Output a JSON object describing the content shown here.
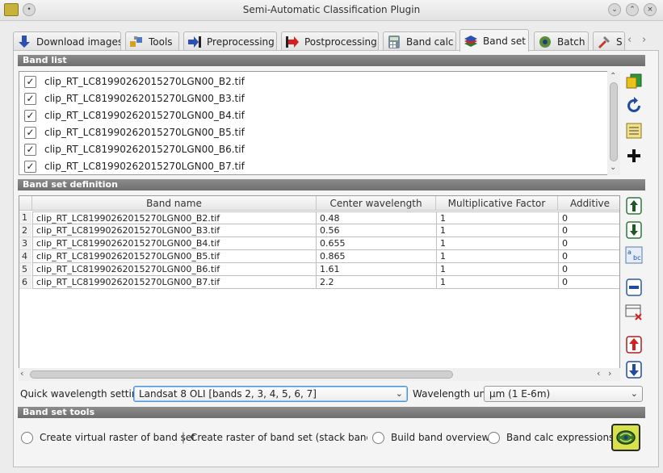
{
  "window": {
    "title": "Semi-Automatic Classification Plugin"
  },
  "tabs": [
    {
      "label": "Download images",
      "icon": "download-icon"
    },
    {
      "label": "Tools",
      "icon": "tools-icon"
    },
    {
      "label": "Preprocessing",
      "icon": "preprocessing-icon"
    },
    {
      "label": "Postprocessing",
      "icon": "postprocessing-icon"
    },
    {
      "label": "Band calc",
      "icon": "calculator-icon"
    },
    {
      "label": "Band set",
      "icon": "layers-icon",
      "active": true
    },
    {
      "label": "Batch",
      "icon": "batch-icon"
    },
    {
      "label": "S",
      "icon": "settings-icon"
    }
  ],
  "band_list": {
    "header": "Band list",
    "items": [
      {
        "label": "clip_RT_LC81990262015270LGN00_B2.tif",
        "checked": true
      },
      {
        "label": "clip_RT_LC81990262015270LGN00_B3.tif",
        "checked": true
      },
      {
        "label": "clip_RT_LC81990262015270LGN00_B4.tif",
        "checked": true
      },
      {
        "label": "clip_RT_LC81990262015270LGN00_B5.tif",
        "checked": true
      },
      {
        "label": "clip_RT_LC81990262015270LGN00_B6.tif",
        "checked": true
      },
      {
        "label": "clip_RT_LC81990262015270LGN00_B7.tif",
        "checked": true
      }
    ]
  },
  "band_set_definition": {
    "header": "Band set definition",
    "columns": [
      "Band name",
      "Center wavelength",
      "Multiplicative Factor",
      "Additive"
    ],
    "rows": [
      {
        "n": "1",
        "name": "clip_RT_LC81990262015270LGN00_B2.tif",
        "wl": "0.48",
        "mult": "1",
        "add": "0"
      },
      {
        "n": "2",
        "name": "clip_RT_LC81990262015270LGN00_B3.tif",
        "wl": "0.56",
        "mult": "1",
        "add": "0"
      },
      {
        "n": "3",
        "name": "clip_RT_LC81990262015270LGN00_B4.tif",
        "wl": "0.655",
        "mult": "1",
        "add": "0"
      },
      {
        "n": "4",
        "name": "clip_RT_LC81990262015270LGN00_B5.tif",
        "wl": "0.865",
        "mult": "1",
        "add": "0"
      },
      {
        "n": "5",
        "name": "clip_RT_LC81990262015270LGN00_B6.tif",
        "wl": "1.61",
        "mult": "1",
        "add": "0"
      },
      {
        "n": "6",
        "name": "clip_RT_LC81990262015270LGN00_B7.tif",
        "wl": "2.2",
        "mult": "1",
        "add": "0"
      }
    ]
  },
  "wavelength": {
    "quick_label": "Quick wavelength settings",
    "quick_value": "Landsat 8 OLI [bands 2, 3, 4, 5, 6, 7]",
    "unit_label": "Wavelength unit",
    "unit_value": "µm (1 E-6m)"
  },
  "band_set_tools": {
    "header": "Band set tools",
    "options": [
      {
        "label": "Create virtual raster of band set",
        "checked": false
      },
      {
        "label": "Create raster of band set (stack bands",
        "checked": false
      },
      {
        "label": "Build band overviews",
        "checked": false
      },
      {
        "label": "Band calc expressions",
        "checked": false
      }
    ]
  },
  "colors": {
    "section_header": "#7a7a7a",
    "accent": "#d8e04c"
  }
}
